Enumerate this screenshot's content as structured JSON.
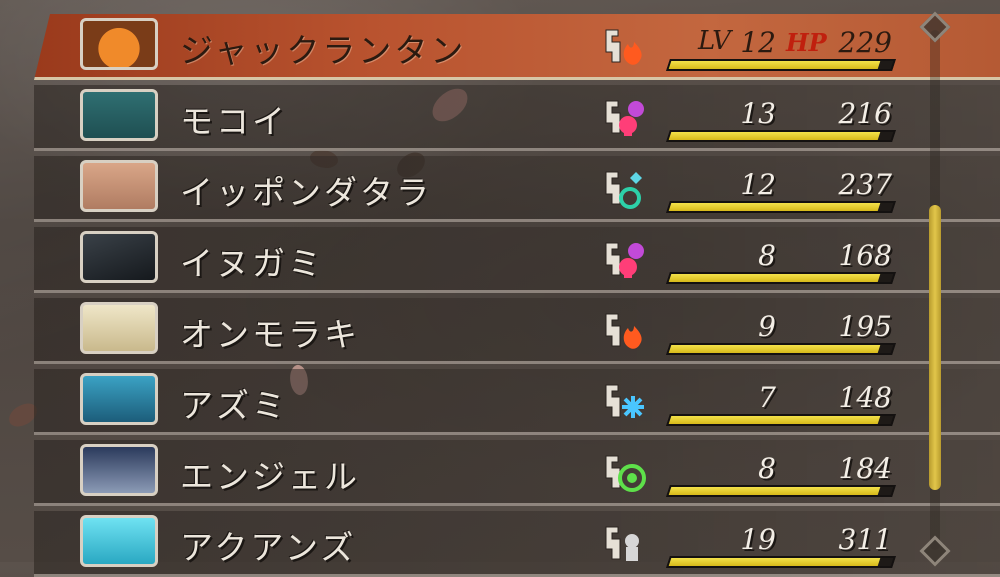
{
  "labels": {
    "lv": "LV",
    "hp": "HP"
  },
  "colors": {
    "selected_row": "#b9532f",
    "hp_bar": "#e2c92a",
    "hp_label": "#c0200e"
  },
  "demons": [
    {
      "name": "ジャックランタン",
      "level": "12",
      "hp": "229",
      "hp_fill": 0.94,
      "element": "fire-icon",
      "portrait": "pumpkin",
      "selected": true
    },
    {
      "name": "モコイ",
      "level": "13",
      "hp": "216",
      "hp_fill": 0.94,
      "element": "curse-icon",
      "portrait": "mokoi",
      "selected": false
    },
    {
      "name": "イッポンダタラ",
      "level": "12",
      "hp": "237",
      "hp_fill": 0.94,
      "element": "heal-icon",
      "portrait": "ippon",
      "selected": false
    },
    {
      "name": "イヌガミ",
      "level": "8",
      "hp": "168",
      "hp_fill": 0.94,
      "element": "curse-icon",
      "portrait": "inugami",
      "selected": false
    },
    {
      "name": "オンモラキ",
      "level": "9",
      "hp": "195",
      "hp_fill": 0.94,
      "element": "fire-icon",
      "portrait": "onmoraki",
      "selected": false
    },
    {
      "name": "アズミ",
      "level": "7",
      "hp": "148",
      "hp_fill": 0.94,
      "element": "ice-icon",
      "portrait": "azumi",
      "selected": false
    },
    {
      "name": "エンジェル",
      "level": "8",
      "hp": "184",
      "hp_fill": 0.94,
      "element": "force-icon",
      "portrait": "angel",
      "selected": false
    },
    {
      "name": "アクアンズ",
      "level": "19",
      "hp": "311",
      "hp_fill": 0.94,
      "element": "water-icon",
      "portrait": "aquans",
      "selected": false
    }
  ]
}
